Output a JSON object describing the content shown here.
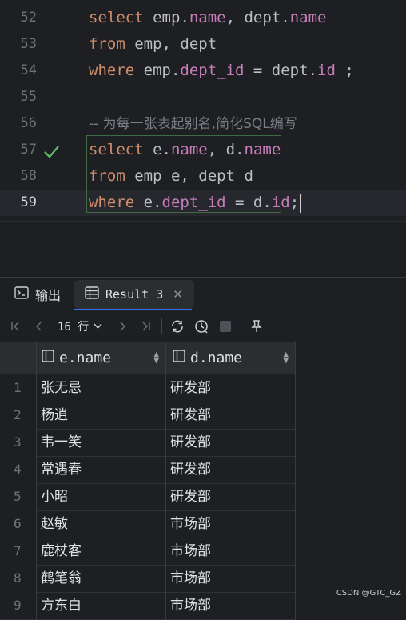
{
  "editor": {
    "lines": [
      {
        "num": "52",
        "tokens": [
          {
            "t": "select",
            "c": "kw"
          },
          {
            "t": " emp.",
            "c": "txt"
          },
          {
            "t": "name",
            "c": "fld"
          },
          {
            "t": ", dept.",
            "c": "txt"
          },
          {
            "t": "name",
            "c": "fld"
          }
        ]
      },
      {
        "num": "53",
        "tokens": [
          {
            "t": "from",
            "c": "kw"
          },
          {
            "t": " emp, dept",
            "c": "txt"
          }
        ]
      },
      {
        "num": "54",
        "tokens": [
          {
            "t": "where",
            "c": "kw"
          },
          {
            "t": " emp.",
            "c": "txt"
          },
          {
            "t": "dept_id",
            "c": "fld"
          },
          {
            "t": " = dept.",
            "c": "txt"
          },
          {
            "t": "id",
            "c": "fld"
          },
          {
            "t": " ;",
            "c": "txt"
          }
        ]
      },
      {
        "num": "55",
        "tokens": []
      },
      {
        "num": "56",
        "tokens": [
          {
            "t": "-- 为每一张表起别名,简化SQL编写",
            "c": "cmt"
          }
        ]
      },
      {
        "num": "57",
        "tokens": [
          {
            "t": "select",
            "c": "kw"
          },
          {
            "t": " e.",
            "c": "txt"
          },
          {
            "t": "name",
            "c": "fld"
          },
          {
            "t": ", d.",
            "c": "txt"
          },
          {
            "t": "name",
            "c": "fld"
          }
        ],
        "mark": "check-icon"
      },
      {
        "num": "58",
        "tokens": [
          {
            "t": "from",
            "c": "kw"
          },
          {
            "t": " emp e, dept d",
            "c": "txt"
          }
        ]
      },
      {
        "num": "59",
        "tokens": [
          {
            "t": "where",
            "c": "kw"
          },
          {
            "t": " e.",
            "c": "txt"
          },
          {
            "t": "dept_id",
            "c": "fld"
          },
          {
            "t": " = d.",
            "c": "txt"
          },
          {
            "t": "id",
            "c": "fld"
          },
          {
            "t": ";",
            "c": "txt"
          }
        ],
        "current": true,
        "caret": true
      }
    ]
  },
  "tabs": {
    "output_label": "输出",
    "result_label": "Result 3",
    "output_icon": "console-icon",
    "result_icon": "table-icon"
  },
  "toolbar": {
    "row_count": "16 行",
    "icons": [
      "first-page-icon",
      "prev-page-icon",
      "next-page-icon",
      "last-page-icon",
      "refresh-icon",
      "history-icon",
      "stop-icon",
      "pin-icon"
    ]
  },
  "grid": {
    "columns": [
      "e.name",
      "d.name"
    ],
    "rows": [
      [
        "1",
        "张无忌",
        "研发部"
      ],
      [
        "2",
        "杨逍",
        "研发部"
      ],
      [
        "3",
        "韦一笑",
        "研发部"
      ],
      [
        "4",
        "常遇春",
        "研发部"
      ],
      [
        "5",
        "小昭",
        "研发部"
      ],
      [
        "6",
        "赵敏",
        "市场部"
      ],
      [
        "7",
        "鹿杖客",
        "市场部"
      ],
      [
        "8",
        "鹤笔翁",
        "市场部"
      ],
      [
        "9",
        "方东白",
        "市场部"
      ]
    ]
  },
  "watermark": "CSDN @GTC_GZ",
  "colors": {
    "keyword": "#cf8e6d",
    "field": "#c77dbb",
    "comment": "#7a7e85",
    "success_check": "#5fb865",
    "accent": "#3574f0"
  }
}
